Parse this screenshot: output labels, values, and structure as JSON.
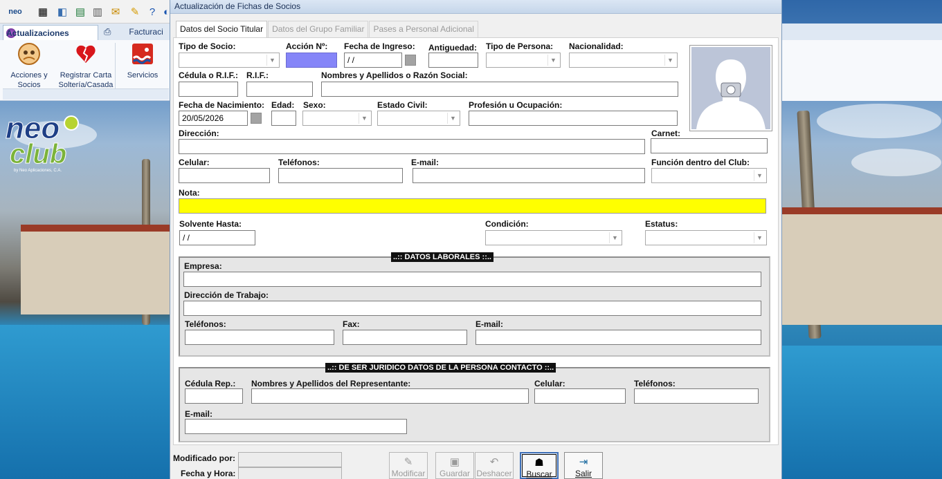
{
  "app": {
    "tabs": {
      "active": "Actualizaciones",
      "next": "Facturaci"
    },
    "ribbon": [
      {
        "label_line1": "Acciones y",
        "label_line2": "Socios"
      },
      {
        "label_line1": "Registrar Carta",
        "label_line2": "Soltería/Casada"
      },
      {
        "label_line1": "Servicios",
        "label_line2": ""
      }
    ],
    "logo": {
      "word1": "neo",
      "word2": "club",
      "tagline": "by Neo Aplicaciones, C.A."
    }
  },
  "dialog": {
    "title": "Actualización de Fichas de Socios",
    "tabs": [
      "Datos del Socio Titular",
      "Datos del Grupo Familiar",
      "Pases a Personal Adicional"
    ],
    "labels": {
      "tipo_socio": "Tipo de Socio:",
      "accion": "Acción Nº:",
      "fecha_ingreso": "Fecha de Ingreso:",
      "antiguedad": "Antiguedad:",
      "tipo_persona": "Tipo de Persona:",
      "nacionalidad": "Nacionalidad:",
      "cedula": "Cédula o R.I.F.:",
      "rif": "R.I.F.:",
      "nombres": "Nombres y Apellidos o Razón Social:",
      "fecha_nac": "Fecha de Nacimiento:",
      "edad": "Edad:",
      "sexo": "Sexo:",
      "estado_civil": "Estado Civil:",
      "profesion": "Profesión u Ocupación:",
      "direccion": "Dirección:",
      "carnet": "Carnet:",
      "celular": "Celular:",
      "telefonos": "Teléfonos:",
      "email": "E-mail:",
      "funcion": "Función dentro del Club:",
      "nota": "Nota:",
      "solvente": "Solvente Hasta:",
      "condicion": "Condición:",
      "estatus": "Estatus:"
    },
    "values": {
      "fecha_ingreso": " / /",
      "fecha_nac": "20/05/2026",
      "solvente": " / /"
    },
    "laborales": {
      "title": "..:: DATOS LABORALES ::..",
      "empresa": "Empresa:",
      "direccion": "Dirección de Trabajo:",
      "telefonos": "Teléfonos:",
      "fax": "Fax:",
      "email": "E-mail:"
    },
    "juridico": {
      "title": "..:: DE SER JURIDICO DATOS DE LA PERSONA CONTACTO ::..",
      "cedula": "Cédula Rep.:",
      "nombres": "Nombres y Apellidos del Representante:",
      "celular": "Celular:",
      "telefonos": "Teléfonos:",
      "email": "E-mail:"
    },
    "footer": {
      "modificado": "Modificado por:",
      "fecha_hora": "Fecha y Hora:",
      "buttons": [
        "Modificar",
        "Guardar",
        "Deshacer",
        "Buscar",
        "Salir"
      ]
    }
  },
  "colors": {
    "accion_field": "#8585f8",
    "nota_field": "#ffff00"
  }
}
